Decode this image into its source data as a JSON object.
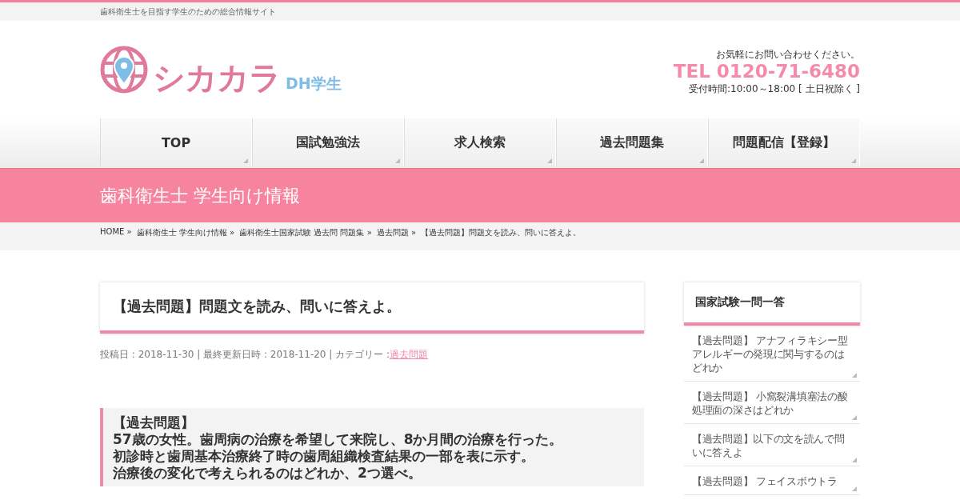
{
  "top_bar": {
    "tagline": "歯科衛生士を目指す学生のための総合情報サイト"
  },
  "header": {
    "logo": {
      "name": "シカカラ",
      "sub": "DH学生"
    },
    "contact": {
      "note": "お気軽にお問い合わせください。",
      "tel": "TEL 0120-71-6480",
      "hours": "受付時間:10:00～18:00 [ 土日祝除く ]"
    }
  },
  "nav": [
    {
      "label": "TOP"
    },
    {
      "label": "国試勉強法"
    },
    {
      "label": "求人検索"
    },
    {
      "label": "過去問題集"
    },
    {
      "label": "問題配信【登録】"
    }
  ],
  "page_banner": {
    "title": "歯科衛生士 学生向け情報"
  },
  "breadcrumb": [
    "HOME »",
    "歯科衛生士 学生向け情報 »",
    "歯科衛生士国家試験 過去問 問題集 »",
    "過去問題 »",
    "【過去問題】問題文を読み、問いに答えよ。"
  ],
  "article": {
    "title": "【過去問題】問題文を読み、問いに答えよ。",
    "meta": "投稿日 : 2018-11-30 | 最終更新日時 : 2018-11-20 | カテゴリー : ",
    "category": "過去問題",
    "question": {
      "lines": [
        "【過去問題】",
        "57歳の女性。歯周病の治療を希望して来院し、8か月間の治療を行った。",
        "初診時と歯周基本治療終了時の歯周組織検査結果の一部を表に示す。",
        "治療後の変化で考えられるのはどれか、2つ選べ。"
      ]
    }
  },
  "sidebar": {
    "title": "国家試験一問一答",
    "items": [
      "【過去問題】 アナフィラキシー型アレルギーの発現に関与するのはどれか",
      "【過去問題】 小窩裂溝填塞法の酸処理面の深さはどれか",
      "【過去問題】以下の文を読んで問いに答えよ",
      "【過去問題】 フェイスボウトラ"
    ]
  }
}
